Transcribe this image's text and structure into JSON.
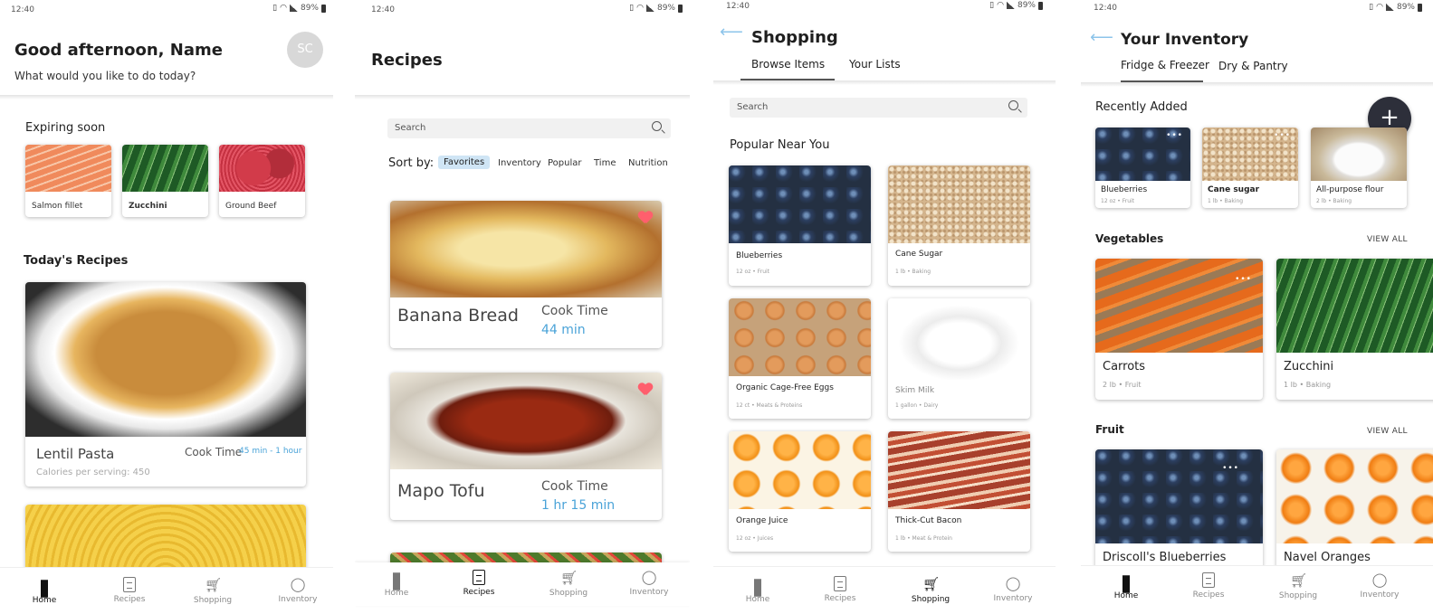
{
  "status": {
    "time": "12:40",
    "battery": "89%"
  },
  "icons": {
    "search": "search-icon",
    "back": "back-arrow-icon",
    "add": "plus-icon",
    "favorite": "heart-icon",
    "home": "grid-icon",
    "recipes": "document-icon",
    "shopping": "cart-icon",
    "inventory": "apple-icon"
  },
  "colors": {
    "accent_blue": "#4aa3d8",
    "heart": "#ff5f6d",
    "fab": "#2d2f3a"
  },
  "nav": {
    "home": "Home",
    "recipes": "Recipes",
    "shopping": "Shopping",
    "inventory": "Inventory"
  },
  "home": {
    "greeting": "Good afternoon, Name",
    "subtitle": "What would you like to do today?",
    "avatar": "SC",
    "expiring_title": "Expiring soon",
    "expiring": [
      {
        "name": "Salmon fillet"
      },
      {
        "name": "Zucchini"
      },
      {
        "name": "Ground Beef"
      }
    ],
    "todays_title": "Today's Recipes",
    "recipe": {
      "title": "Lentil Pasta",
      "cook_label": "Cook Time",
      "time": "45 min - 1 hour",
      "calories": "Calories per serving: 450"
    }
  },
  "recipes": {
    "title": "Recipes",
    "search_placeholder": "Search",
    "sort_label": "Sort by:",
    "sort_options": [
      "Favorites",
      "Inventory",
      "Popular",
      "Time",
      "Nutrition"
    ],
    "cards": [
      {
        "title": "Banana Bread",
        "cook_label": "Cook Time",
        "time": "44 min"
      },
      {
        "title": "Mapo Tofu",
        "cook_label": "Cook Time",
        "time": "1 hr 15 min"
      }
    ]
  },
  "shopping": {
    "title": "Shopping",
    "tabs": [
      "Browse Items",
      "Your Lists"
    ],
    "search_placeholder": "Search",
    "section": "Popular Near You",
    "items": [
      {
        "name": "Blueberries",
        "meta": "12 oz • Fruit"
      },
      {
        "name": "Cane Sugar",
        "meta": "1 lb • Baking"
      },
      {
        "name": "Organic Cage-Free Eggs",
        "meta": "12 ct • Meats & Proteins"
      },
      {
        "name": "Skim Milk",
        "meta": "1 gallon • Dairy"
      },
      {
        "name": "Orange Juice",
        "meta": "12 oz • Juices"
      },
      {
        "name": "Thick-Cut Bacon",
        "meta": "1 lb • Meat & Protein"
      }
    ]
  },
  "inventory": {
    "title": "Your Inventory",
    "tabs": [
      "Fridge & Freezer",
      "Dry & Pantry"
    ],
    "recent_title": "Recently Added",
    "recent": [
      {
        "name": "Blueberries",
        "meta": "12 oz • Fruit"
      },
      {
        "name": "Cane sugar",
        "meta": "1 lb • Baking"
      },
      {
        "name": "All-purpose flour",
        "meta": "2 lb • Baking"
      }
    ],
    "veg_title": "Vegetables",
    "view_all": "VIEW ALL",
    "vegetables": [
      {
        "name": "Carrots",
        "meta": "2 lb • Fruit"
      },
      {
        "name": "Zucchini",
        "meta": "1 lb • Baking"
      }
    ],
    "fruit_title": "Fruit",
    "fruit": [
      {
        "name": "Driscoll's Blueberries"
      },
      {
        "name": "Navel Oranges"
      }
    ]
  }
}
